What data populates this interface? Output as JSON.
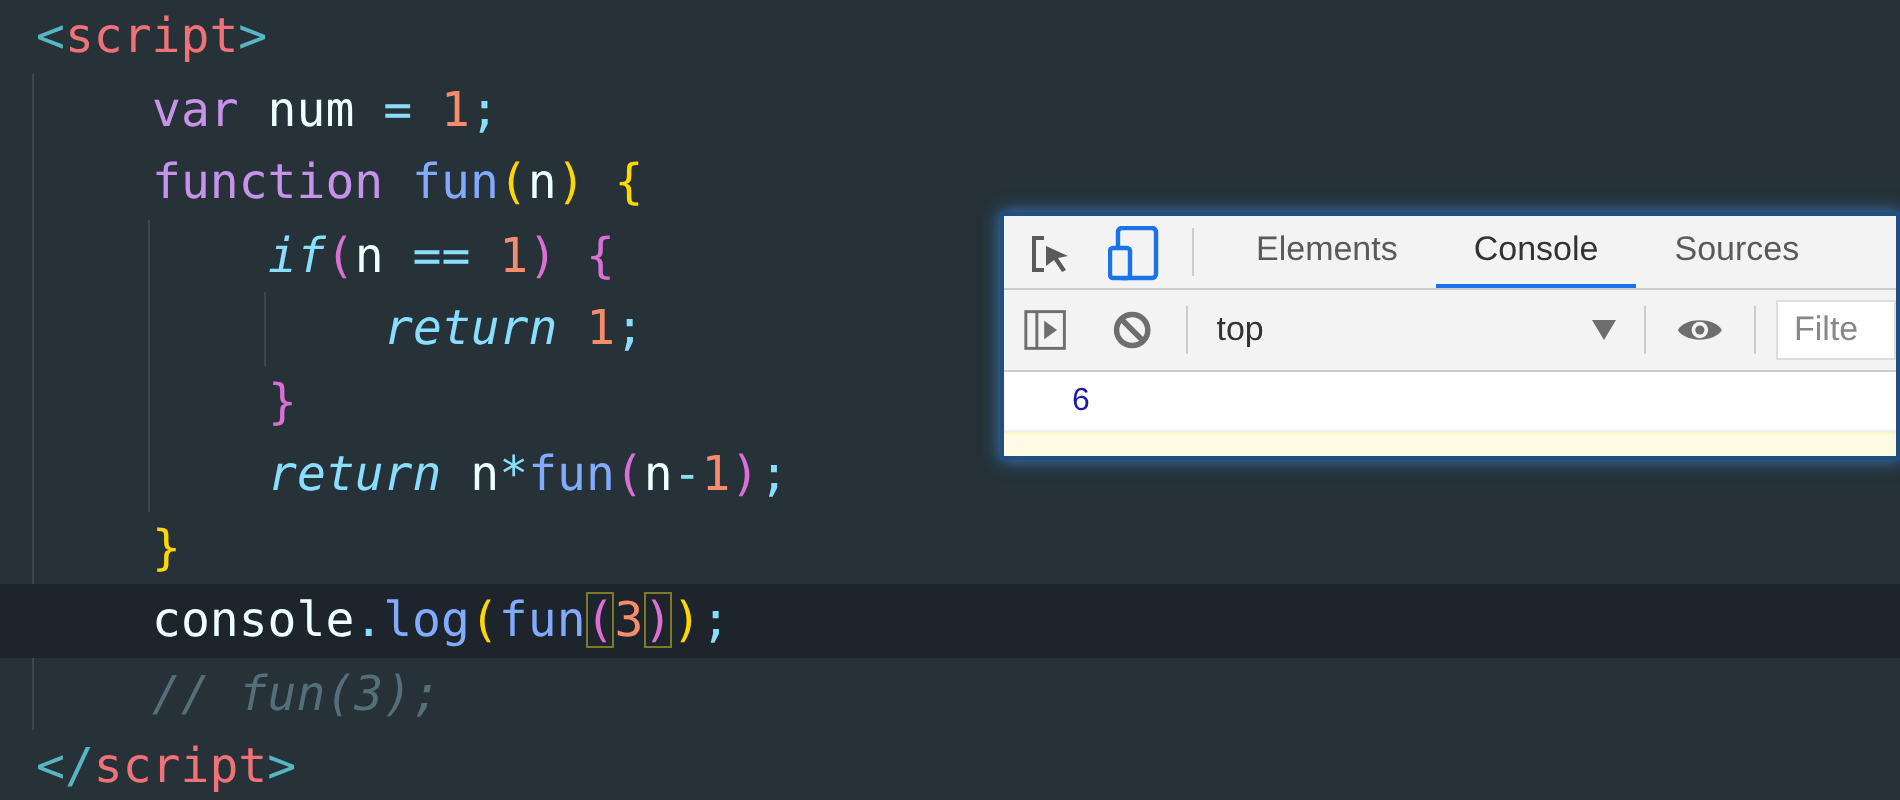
{
  "editor": {
    "lines": [
      {
        "current": false,
        "tokens": [
          {
            "kind": "tag-bracket",
            "text": "<"
          },
          {
            "kind": "tag",
            "text": "script"
          },
          {
            "kind": "tag-bracket",
            "text": ">"
          }
        ],
        "children": [
          {
            "current": false,
            "tokens": [
              {
                "kind": "keyword",
                "text": "var"
              },
              {
                "kind": "plain",
                "text": " num "
              },
              {
                "kind": "operator",
                "text": "="
              },
              {
                "kind": "number",
                "text": " 1"
              },
              {
                "kind": "operator",
                "text": ";"
              }
            ]
          },
          {
            "current": false,
            "tokens": [
              {
                "kind": "keyword",
                "text": "function"
              },
              {
                "kind": "function",
                "text": " fun"
              },
              {
                "kind": "paren-yellow",
                "text": "("
              },
              {
                "kind": "plain",
                "text": "n"
              },
              {
                "kind": "paren-yellow",
                "text": ")"
              },
              {
                "kind": "paren-yellow",
                "text": " {"
              }
            ],
            "children": [
              {
                "current": false,
                "tokens": [
                  {
                    "kind": "control",
                    "text": "if"
                  },
                  {
                    "kind": "paren-pink",
                    "text": "("
                  },
                  {
                    "kind": "plain",
                    "text": "n "
                  },
                  {
                    "kind": "operator",
                    "text": "=="
                  },
                  {
                    "kind": "number",
                    "text": " 1"
                  },
                  {
                    "kind": "paren-pink",
                    "text": ")"
                  },
                  {
                    "kind": "paren-pink",
                    "text": " {"
                  }
                ],
                "children": [
                  {
                    "current": false,
                    "tokens": [
                      {
                        "kind": "control",
                        "text": "return"
                      },
                      {
                        "kind": "number",
                        "text": " 1"
                      },
                      {
                        "kind": "operator",
                        "text": ";"
                      }
                    ]
                  }
                ]
              },
              {
                "current": false,
                "tokens": [
                  {
                    "kind": "paren-pink",
                    "text": "}"
                  }
                ]
              },
              {
                "current": false,
                "tokens": [
                  {
                    "kind": "control",
                    "text": "return"
                  },
                  {
                    "kind": "plain",
                    "text": " n"
                  },
                  {
                    "kind": "operator",
                    "text": "*"
                  },
                  {
                    "kind": "function",
                    "text": "fun"
                  },
                  {
                    "kind": "paren-pink",
                    "text": "("
                  },
                  {
                    "kind": "plain",
                    "text": "n"
                  },
                  {
                    "kind": "operator",
                    "text": "-"
                  },
                  {
                    "kind": "number",
                    "text": "1"
                  },
                  {
                    "kind": "paren-pink",
                    "text": ")"
                  },
                  {
                    "kind": "operator",
                    "text": ";"
                  }
                ]
              }
            ]
          },
          {
            "current": false,
            "tokens": [
              {
                "kind": "paren-yellow",
                "text": "}"
              }
            ]
          },
          {
            "current": true,
            "tokens": [
              {
                "kind": "plain",
                "text": "console"
              },
              {
                "kind": "operator",
                "text": "."
              },
              {
                "kind": "function",
                "text": "log"
              },
              {
                "kind": "paren-yellow",
                "text": "("
              },
              {
                "kind": "function",
                "text": "fun"
              },
              {
                "kind": "paren-matched",
                "text": "("
              },
              {
                "kind": "number",
                "text": "3"
              },
              {
                "kind": "paren-matched",
                "text": ")"
              },
              {
                "kind": "paren-yellow",
                "text": ")"
              },
              {
                "kind": "operator",
                "text": ";"
              }
            ]
          },
          {
            "current": false,
            "tokens": [
              {
                "kind": "comment",
                "text": "// fun(3);"
              }
            ]
          }
        ]
      },
      {
        "current": false,
        "tokens": [
          {
            "kind": "tag-bracket",
            "text": "</"
          },
          {
            "kind": "tag",
            "text": "script"
          },
          {
            "kind": "tag-bracket",
            "text": ">"
          }
        ]
      }
    ]
  },
  "devtools": {
    "tabs": [
      {
        "label": "Elements",
        "selected": false
      },
      {
        "label": "Console",
        "selected": true
      },
      {
        "label": "Sources",
        "selected": false
      }
    ],
    "context": "top",
    "filter": {
      "placeholder": "Filte"
    },
    "output": [
      {
        "kind": "value",
        "text": "6"
      },
      {
        "kind": "warning"
      }
    ]
  }
}
